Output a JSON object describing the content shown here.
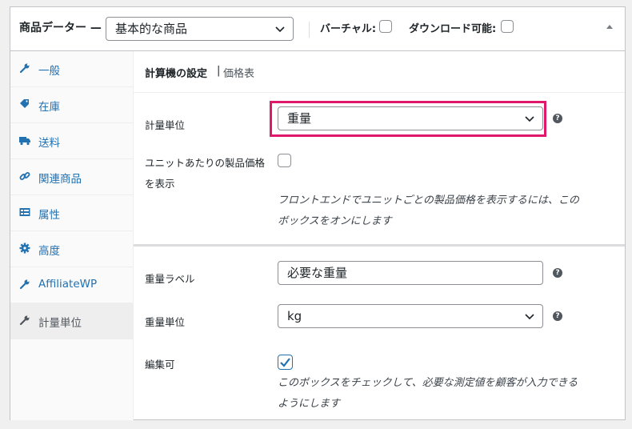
{
  "header": {
    "title": "商品データー —",
    "product_type": "基本的な商品",
    "virtual_label": "バーチャル:",
    "downloadable_label": "ダウンロード可能:",
    "collapse_icon": "triangle-up-icon"
  },
  "sidebar": {
    "items": [
      {
        "label": "一般",
        "icon": "wrench-icon"
      },
      {
        "label": "在庫",
        "icon": "tag-icon"
      },
      {
        "label": "送料",
        "icon": "truck-icon"
      },
      {
        "label": "関連商品",
        "icon": "link-icon"
      },
      {
        "label": "属性",
        "icon": "list-card-icon"
      },
      {
        "label": "高度",
        "icon": "gear-icon"
      },
      {
        "label": "AffiliateWP",
        "icon": "wrench-icon"
      },
      {
        "label": "計量単位",
        "icon": "wrench-icon",
        "active": true
      }
    ]
  },
  "subnav": {
    "current": "計算機の設定",
    "separator": "|",
    "other": "価格表"
  },
  "fields": {
    "measurement_label": "計量単位",
    "measurement_value": "重量",
    "unit_price_label_line1": "ユニットあたりの製品価格",
    "unit_price_label_line2": "を表示",
    "unit_price_desc_line1": "フロントエンドでユニットごとの製品価格を表示するには、この",
    "unit_price_desc_line2": "ボックスをオンにします",
    "weight_label_label": "重量ラベル",
    "weight_label_value": "必要な重量",
    "weight_unit_label": "重量単位",
    "weight_unit_value": "kg",
    "editable_label": "編集可",
    "editable_checked": true,
    "editable_desc_line1": "このボックスをチェックして、必要な測定値を顧客が入力できる",
    "editable_desc_line2": "ようにします",
    "help_glyph": "?"
  },
  "colors": {
    "link": "#2271b1",
    "highlight": "#e0186c",
    "checkbox_checked": "#2271b1"
  }
}
